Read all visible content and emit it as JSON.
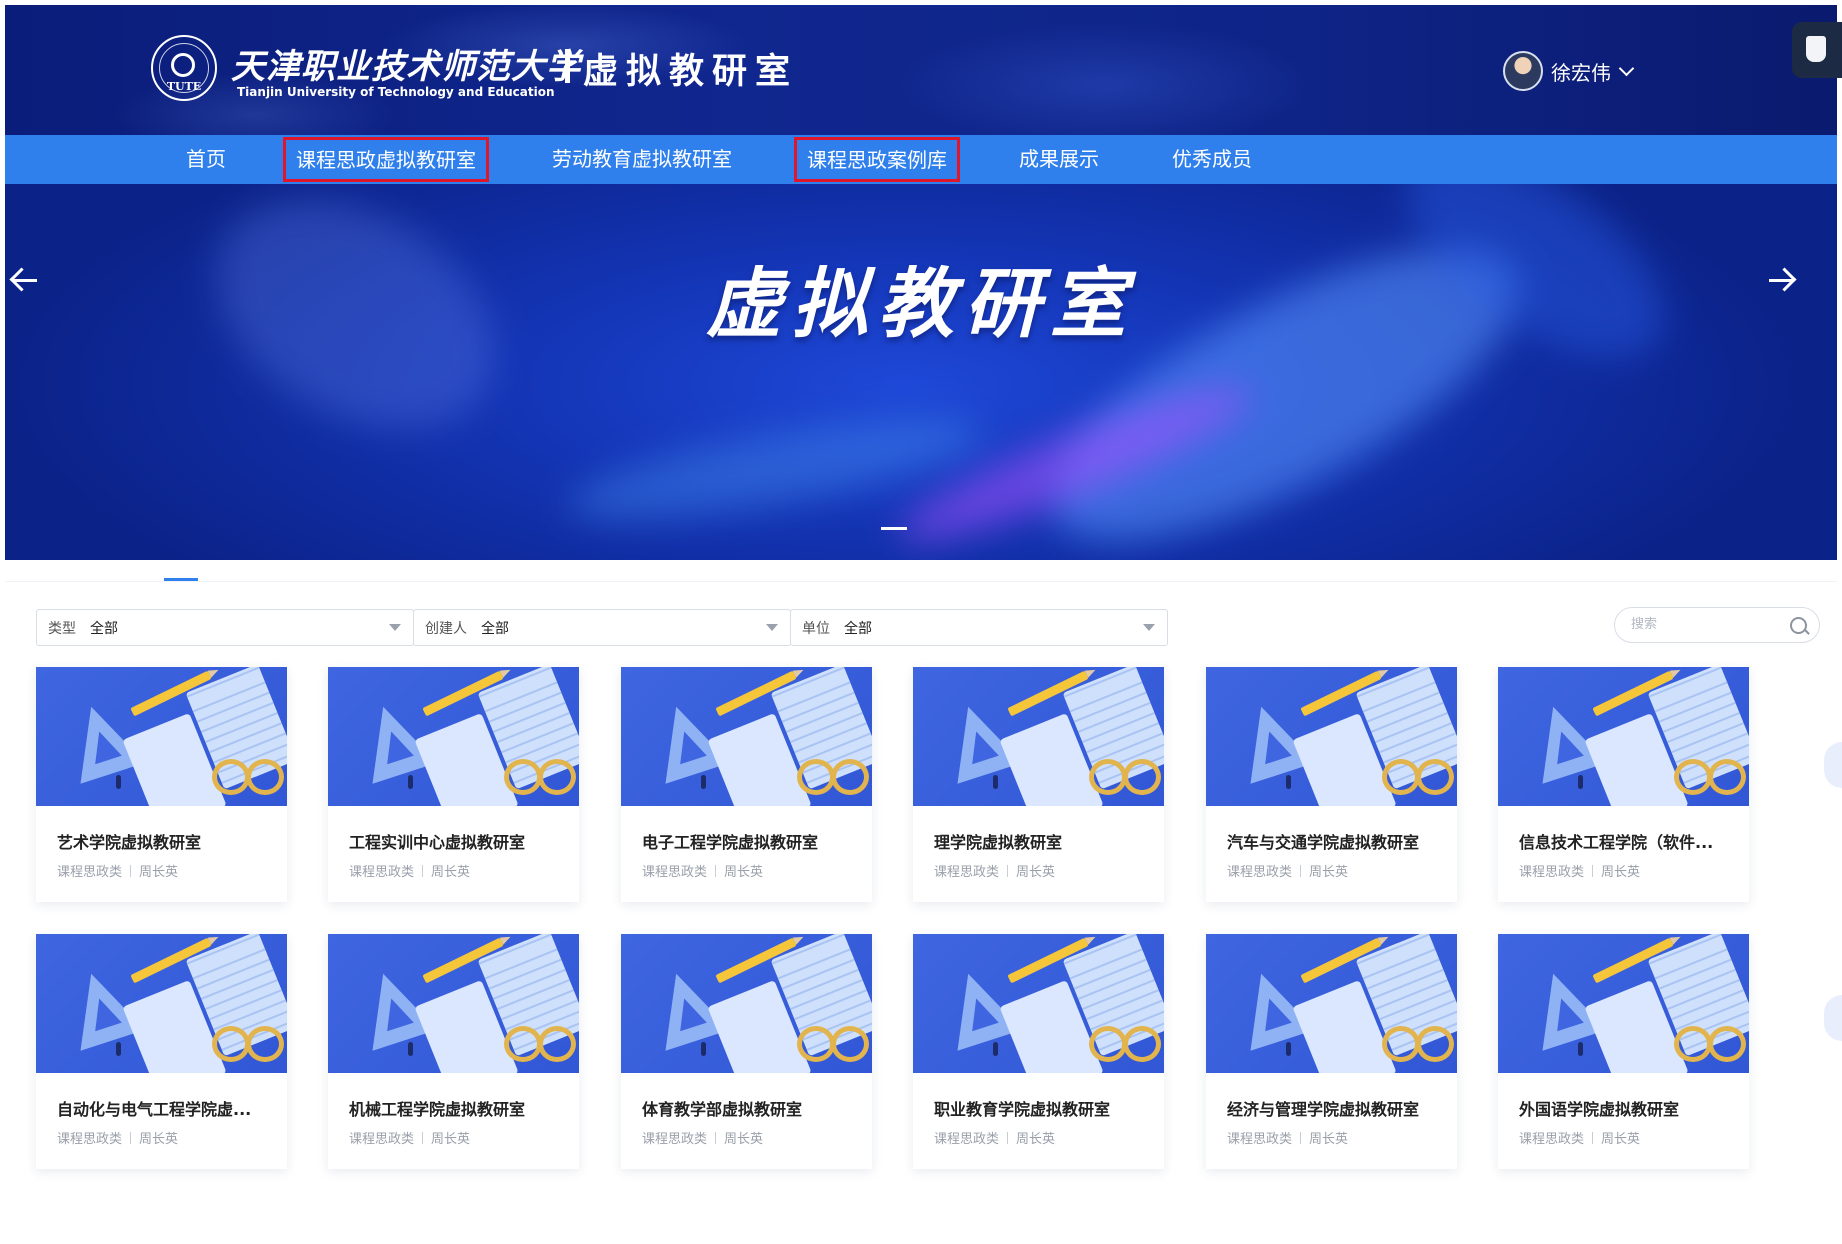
{
  "header": {
    "logo_text": "TUTE",
    "university_cn": "天津职业技术师范大学",
    "university_en": "Tianjin University of Technology and Education",
    "site_title": "虚拟教研室",
    "user_name": "徐宏伟"
  },
  "nav": {
    "items": [
      {
        "label": "首页",
        "boxed": false
      },
      {
        "label": "课程思政虚拟教研室",
        "boxed": true
      },
      {
        "label": "劳动教育虚拟教研室",
        "boxed": false
      },
      {
        "label": "课程思政案例库",
        "boxed": true
      },
      {
        "label": "成果展示",
        "boxed": false
      },
      {
        "label": "优秀成员",
        "boxed": false
      }
    ]
  },
  "banner": {
    "title": "虚拟教研室"
  },
  "filters": [
    {
      "label": "类型",
      "value": "全部"
    },
    {
      "label": "创建人",
      "value": "全部"
    },
    {
      "label": "单位",
      "value": "全部"
    }
  ],
  "search": {
    "placeholder": "搜索"
  },
  "cards": [
    {
      "title": "艺术学院虚拟教研室",
      "category": "课程思政类",
      "creator": "周长英"
    },
    {
      "title": "工程实训中心虚拟教研室",
      "category": "课程思政类",
      "creator": "周长英"
    },
    {
      "title": "电子工程学院虚拟教研室",
      "category": "课程思政类",
      "creator": "周长英"
    },
    {
      "title": "理学院虚拟教研室",
      "category": "课程思政类",
      "creator": "周长英"
    },
    {
      "title": "汽车与交通学院虚拟教研室",
      "category": "课程思政类",
      "creator": "周长英"
    },
    {
      "title": "信息技术工程学院（软件...",
      "category": "课程思政类",
      "creator": "周长英"
    },
    {
      "title": "自动化与电气工程学院虚...",
      "category": "课程思政类",
      "creator": "周长英"
    },
    {
      "title": "机械工程学院虚拟教研室",
      "category": "课程思政类",
      "creator": "周长英"
    },
    {
      "title": "体育教学部虚拟教研室",
      "category": "课程思政类",
      "creator": "周长英"
    },
    {
      "title": "职业教育学院虚拟教研室",
      "category": "课程思政类",
      "creator": "周长英"
    },
    {
      "title": "经济与管理学院虚拟教研室",
      "category": "课程思政类",
      "creator": "周长英"
    },
    {
      "title": "外国语学院虚拟教研室",
      "category": "课程思政类",
      "creator": "周长英"
    }
  ],
  "colors": {
    "nav_bg": "#2f80ed",
    "highlight_box": "#e0172a",
    "header_bg": "#10278f"
  }
}
